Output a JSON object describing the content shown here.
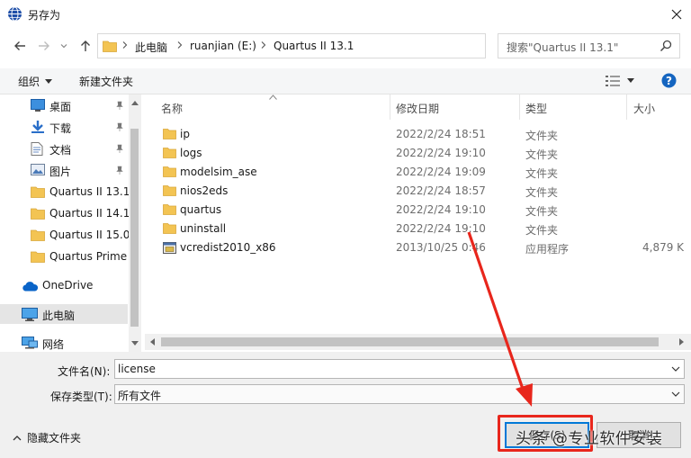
{
  "window": {
    "title": "另存为"
  },
  "breadcrumb": [
    "此电脑",
    "ruanjian (E:)",
    "Quartus II 13.1"
  ],
  "search": {
    "placeholder": "搜索\"Quartus II 13.1\""
  },
  "toolbar": {
    "organize": "组织",
    "new_folder": "新建文件夹"
  },
  "nav": {
    "items": [
      {
        "label": "桌面",
        "icon": "desktop-icon",
        "pinned": true
      },
      {
        "label": "下载",
        "icon": "download-icon",
        "pinned": true
      },
      {
        "label": "文档",
        "icon": "document-icon",
        "pinned": true
      },
      {
        "label": "图片",
        "icon": "picture-icon",
        "pinned": true
      },
      {
        "label": "Quartus II 13.1",
        "icon": "folder-icon",
        "pinned": false
      },
      {
        "label": "Quartus II 14.1",
        "icon": "folder-icon",
        "pinned": false
      },
      {
        "label": "Quartus II 15.0",
        "icon": "folder-icon",
        "pinned": false
      },
      {
        "label": "Quartus Prime",
        "icon": "folder-icon",
        "pinned": false
      },
      {
        "label": "OneDrive",
        "icon": "cloud-icon",
        "pinned": false
      },
      {
        "label": "此电脑",
        "icon": "computer-icon",
        "pinned": false,
        "selected": true
      },
      {
        "label": "网络",
        "icon": "network-icon",
        "pinned": false
      }
    ]
  },
  "columns": {
    "name": "名称",
    "date": "修改日期",
    "type": "类型",
    "size": "大小"
  },
  "files": [
    {
      "name": "ip",
      "date": "2022/2/24 18:51",
      "type": "文件夹",
      "size": "",
      "icon": "folder-icon"
    },
    {
      "name": "logs",
      "date": "2022/2/24 19:10",
      "type": "文件夹",
      "size": "",
      "icon": "folder-icon"
    },
    {
      "name": "modelsim_ase",
      "date": "2022/2/24 19:09",
      "type": "文件夹",
      "size": "",
      "icon": "folder-icon"
    },
    {
      "name": "nios2eds",
      "date": "2022/2/24 18:57",
      "type": "文件夹",
      "size": "",
      "icon": "folder-icon"
    },
    {
      "name": "quartus",
      "date": "2022/2/24 19:10",
      "type": "文件夹",
      "size": "",
      "icon": "folder-icon"
    },
    {
      "name": "uninstall",
      "date": "2022/2/24 19:10",
      "type": "文件夹",
      "size": "",
      "icon": "folder-icon"
    },
    {
      "name": "vcredist2010_x86",
      "date": "2013/10/25 0:46",
      "type": "应用程序",
      "size": "4,879 K",
      "icon": "exe-icon"
    }
  ],
  "form": {
    "filename_label": "文件名(N):",
    "filename_value": "license",
    "filetype_label": "保存类型(T):",
    "filetype_value": "所有文件"
  },
  "footer": {
    "hide_folders": "隐藏文件夹",
    "save": "保存(S)",
    "cancel": "取消"
  },
  "watermark": "头条 @专业软件安装",
  "colors": {
    "accent": "#0078d7",
    "annotation_red": "#e8261c",
    "folder": "#f3c453"
  }
}
